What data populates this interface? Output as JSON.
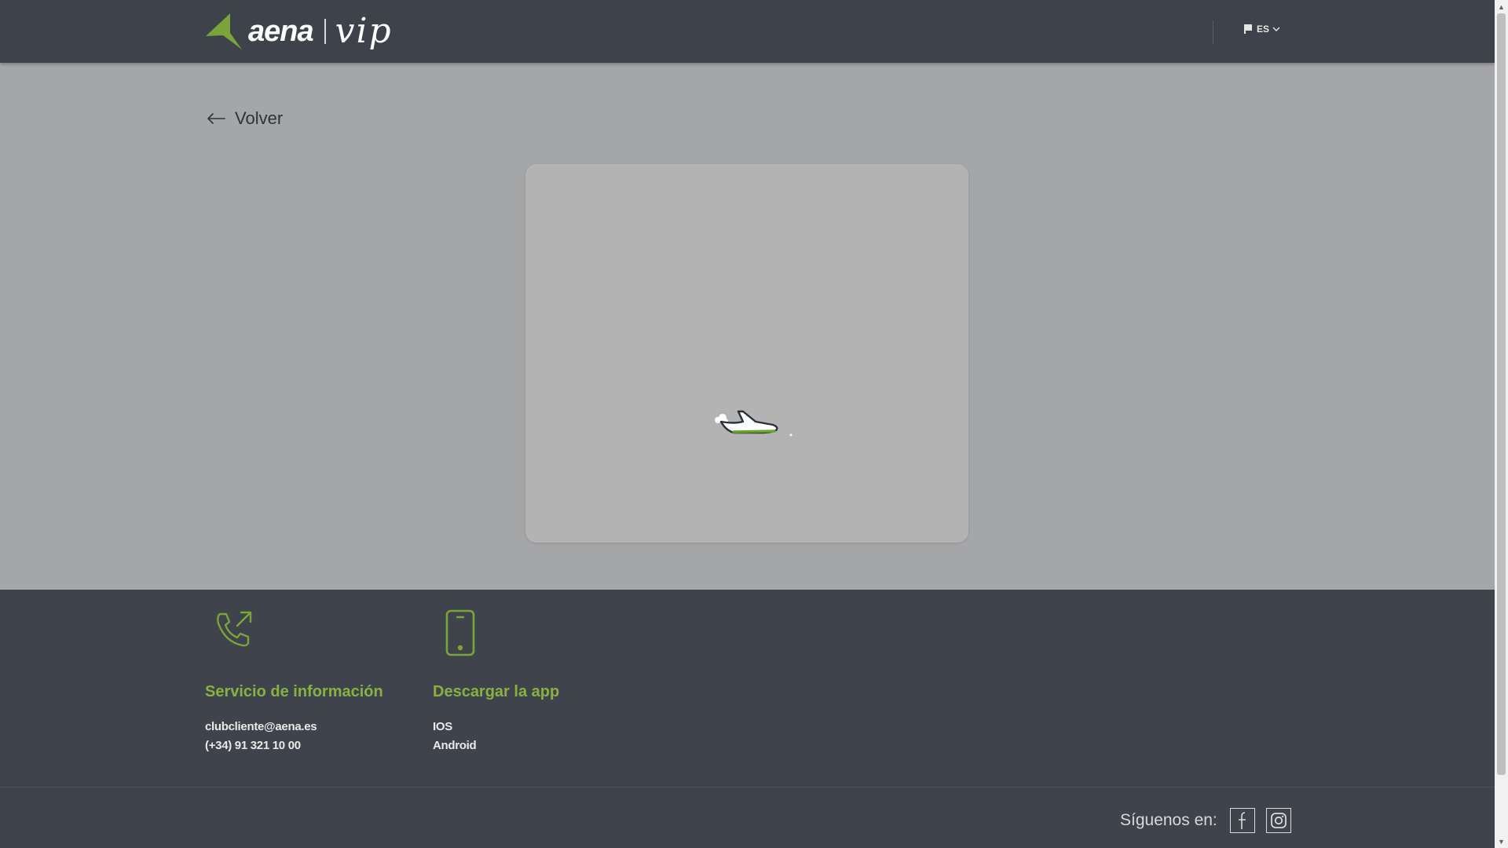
{
  "brand": {
    "name": "aena",
    "product": "vip",
    "accent_color": "#7ba43a",
    "header_bg": "#3e434b"
  },
  "header": {
    "language": "ES",
    "language_icon": "flag-icon",
    "dropdown_icon": "chevron-down-icon"
  },
  "nav": {
    "back_label": "Volver",
    "back_icon": "arrow-left-icon"
  },
  "loader": {
    "icon": "airplane-icon"
  },
  "footer": {
    "info": {
      "icon": "phone-call-icon",
      "title": "Servicio de información",
      "email": "clubcliente@aena.es",
      "phone": "(+34) 91 321 10 00"
    },
    "app": {
      "icon": "smartphone-icon",
      "title": "Descargar la app",
      "ios": "IOS",
      "android": "Android"
    },
    "social": {
      "label": "Síguenos en:",
      "networks": [
        "facebook-icon",
        "instagram-icon"
      ]
    }
  }
}
